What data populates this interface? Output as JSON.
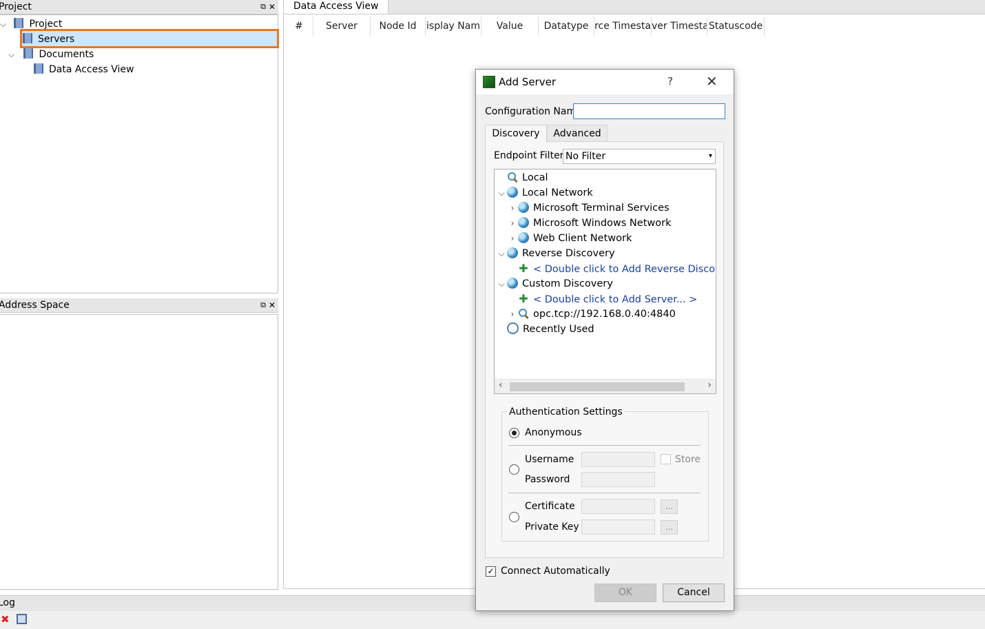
{
  "project_panel": {
    "title": "Project",
    "tree": [
      {
        "label": "Project"
      },
      {
        "label": "Servers"
      },
      {
        "label": "Documents"
      },
      {
        "label": "Data Access View"
      }
    ]
  },
  "address_panel": {
    "title": "Address Space"
  },
  "data_view": {
    "tab": "Data Access View",
    "columns": [
      "#",
      "Server",
      "Node Id",
      "isplay Nam",
      "Value",
      "Datatype",
      "rce Timesta",
      "ver Timesta",
      "Statuscode"
    ]
  },
  "log_panel": {
    "title": "Log"
  },
  "dialog": {
    "title": "Add Server",
    "help": "?",
    "config_name_label": "Configuration Name",
    "config_name_value": "",
    "tabs": [
      "Discovery",
      "Advanced"
    ],
    "endpoint_filter_label": "Endpoint Filter:",
    "endpoint_filter_value": "No Filter",
    "discovery_tree": [
      {
        "label": "Local"
      },
      {
        "label": "Local Network"
      },
      {
        "label": "Microsoft Terminal Services"
      },
      {
        "label": "Microsoft Windows Network"
      },
      {
        "label": "Web Client Network"
      },
      {
        "label": "Reverse Discovery"
      },
      {
        "label": "< Double click to Add Reverse Discovery"
      },
      {
        "label": "Custom Discovery"
      },
      {
        "label": "< Double click to Add Server... >"
      },
      {
        "label": "opc.tcp://192.168.0.40:4840"
      },
      {
        "label": "Recently Used"
      }
    ],
    "auth": {
      "title": "Authentication Settings",
      "anonymous": "Anonymous",
      "username": "Username",
      "password": "Password",
      "store": "Store",
      "certificate": "Certificate",
      "private_key": "Private Key",
      "browse": "..."
    },
    "connect_auto": "Connect Automatically",
    "ok": "OK",
    "cancel": "Cancel"
  },
  "colors": {
    "selection_outline": "#e87722",
    "link": "#1a3fa6"
  }
}
